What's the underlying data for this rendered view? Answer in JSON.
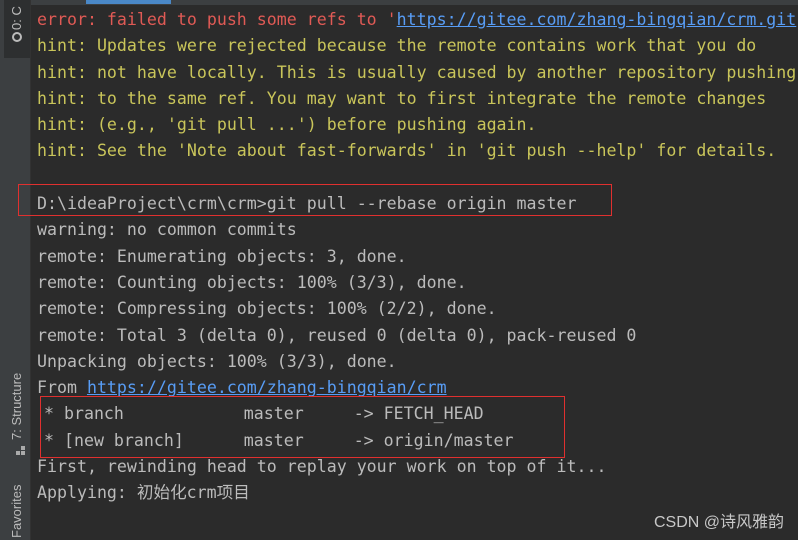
{
  "sidebar": {
    "tabs": [
      {
        "label": "0: C",
        "icon": "console-icon"
      },
      {
        "label": "7: Structure",
        "icon": "structure-icon"
      },
      {
        "label": "Favorites"
      }
    ]
  },
  "console": {
    "error_prefix": "error: failed to push some refs to '",
    "error_url": "https://gitee.com/zhang-bingqian/crm.git",
    "hints": [
      "hint: Updates were rejected because the remote contains work that you do",
      "hint: not have locally. This is usually caused by another repository pushing",
      "hint: to the same ref. You may want to first integrate the remote changes",
      "hint: (e.g., 'git pull ...') before pushing again.",
      "hint: See the 'Note about fast-forwards' in 'git push --help' for details."
    ],
    "command": "D:\\ideaProject\\crm\\crm>git pull --rebase origin master",
    "output": [
      "warning: no common commits",
      "remote: Enumerating objects: 3, done.",
      "remote: Counting objects: 100% (3/3), done.",
      "remote: Compressing objects: 100% (2/2), done.",
      "remote: Total 3 (delta 0), reused 0 (delta 0), pack-reused 0",
      "Unpacking objects: 100% (3/3), done."
    ],
    "from_prefix": "From ",
    "from_url": "https://gitee.com/zhang-bingqian/crm",
    "branches": [
      " * branch            master     -> FETCH_HEAD",
      " * [new branch]      master     -> origin/master"
    ],
    "after": [
      "First, rewinding head to replay your work on top of it...",
      "Applying: 初始化crm项目"
    ]
  },
  "colors": {
    "error": "#e05a55",
    "hint": "#c9c55a",
    "link": "#589df6",
    "highlight_box": "#e0302f"
  },
  "watermark": "CSDN @诗风雅韵"
}
